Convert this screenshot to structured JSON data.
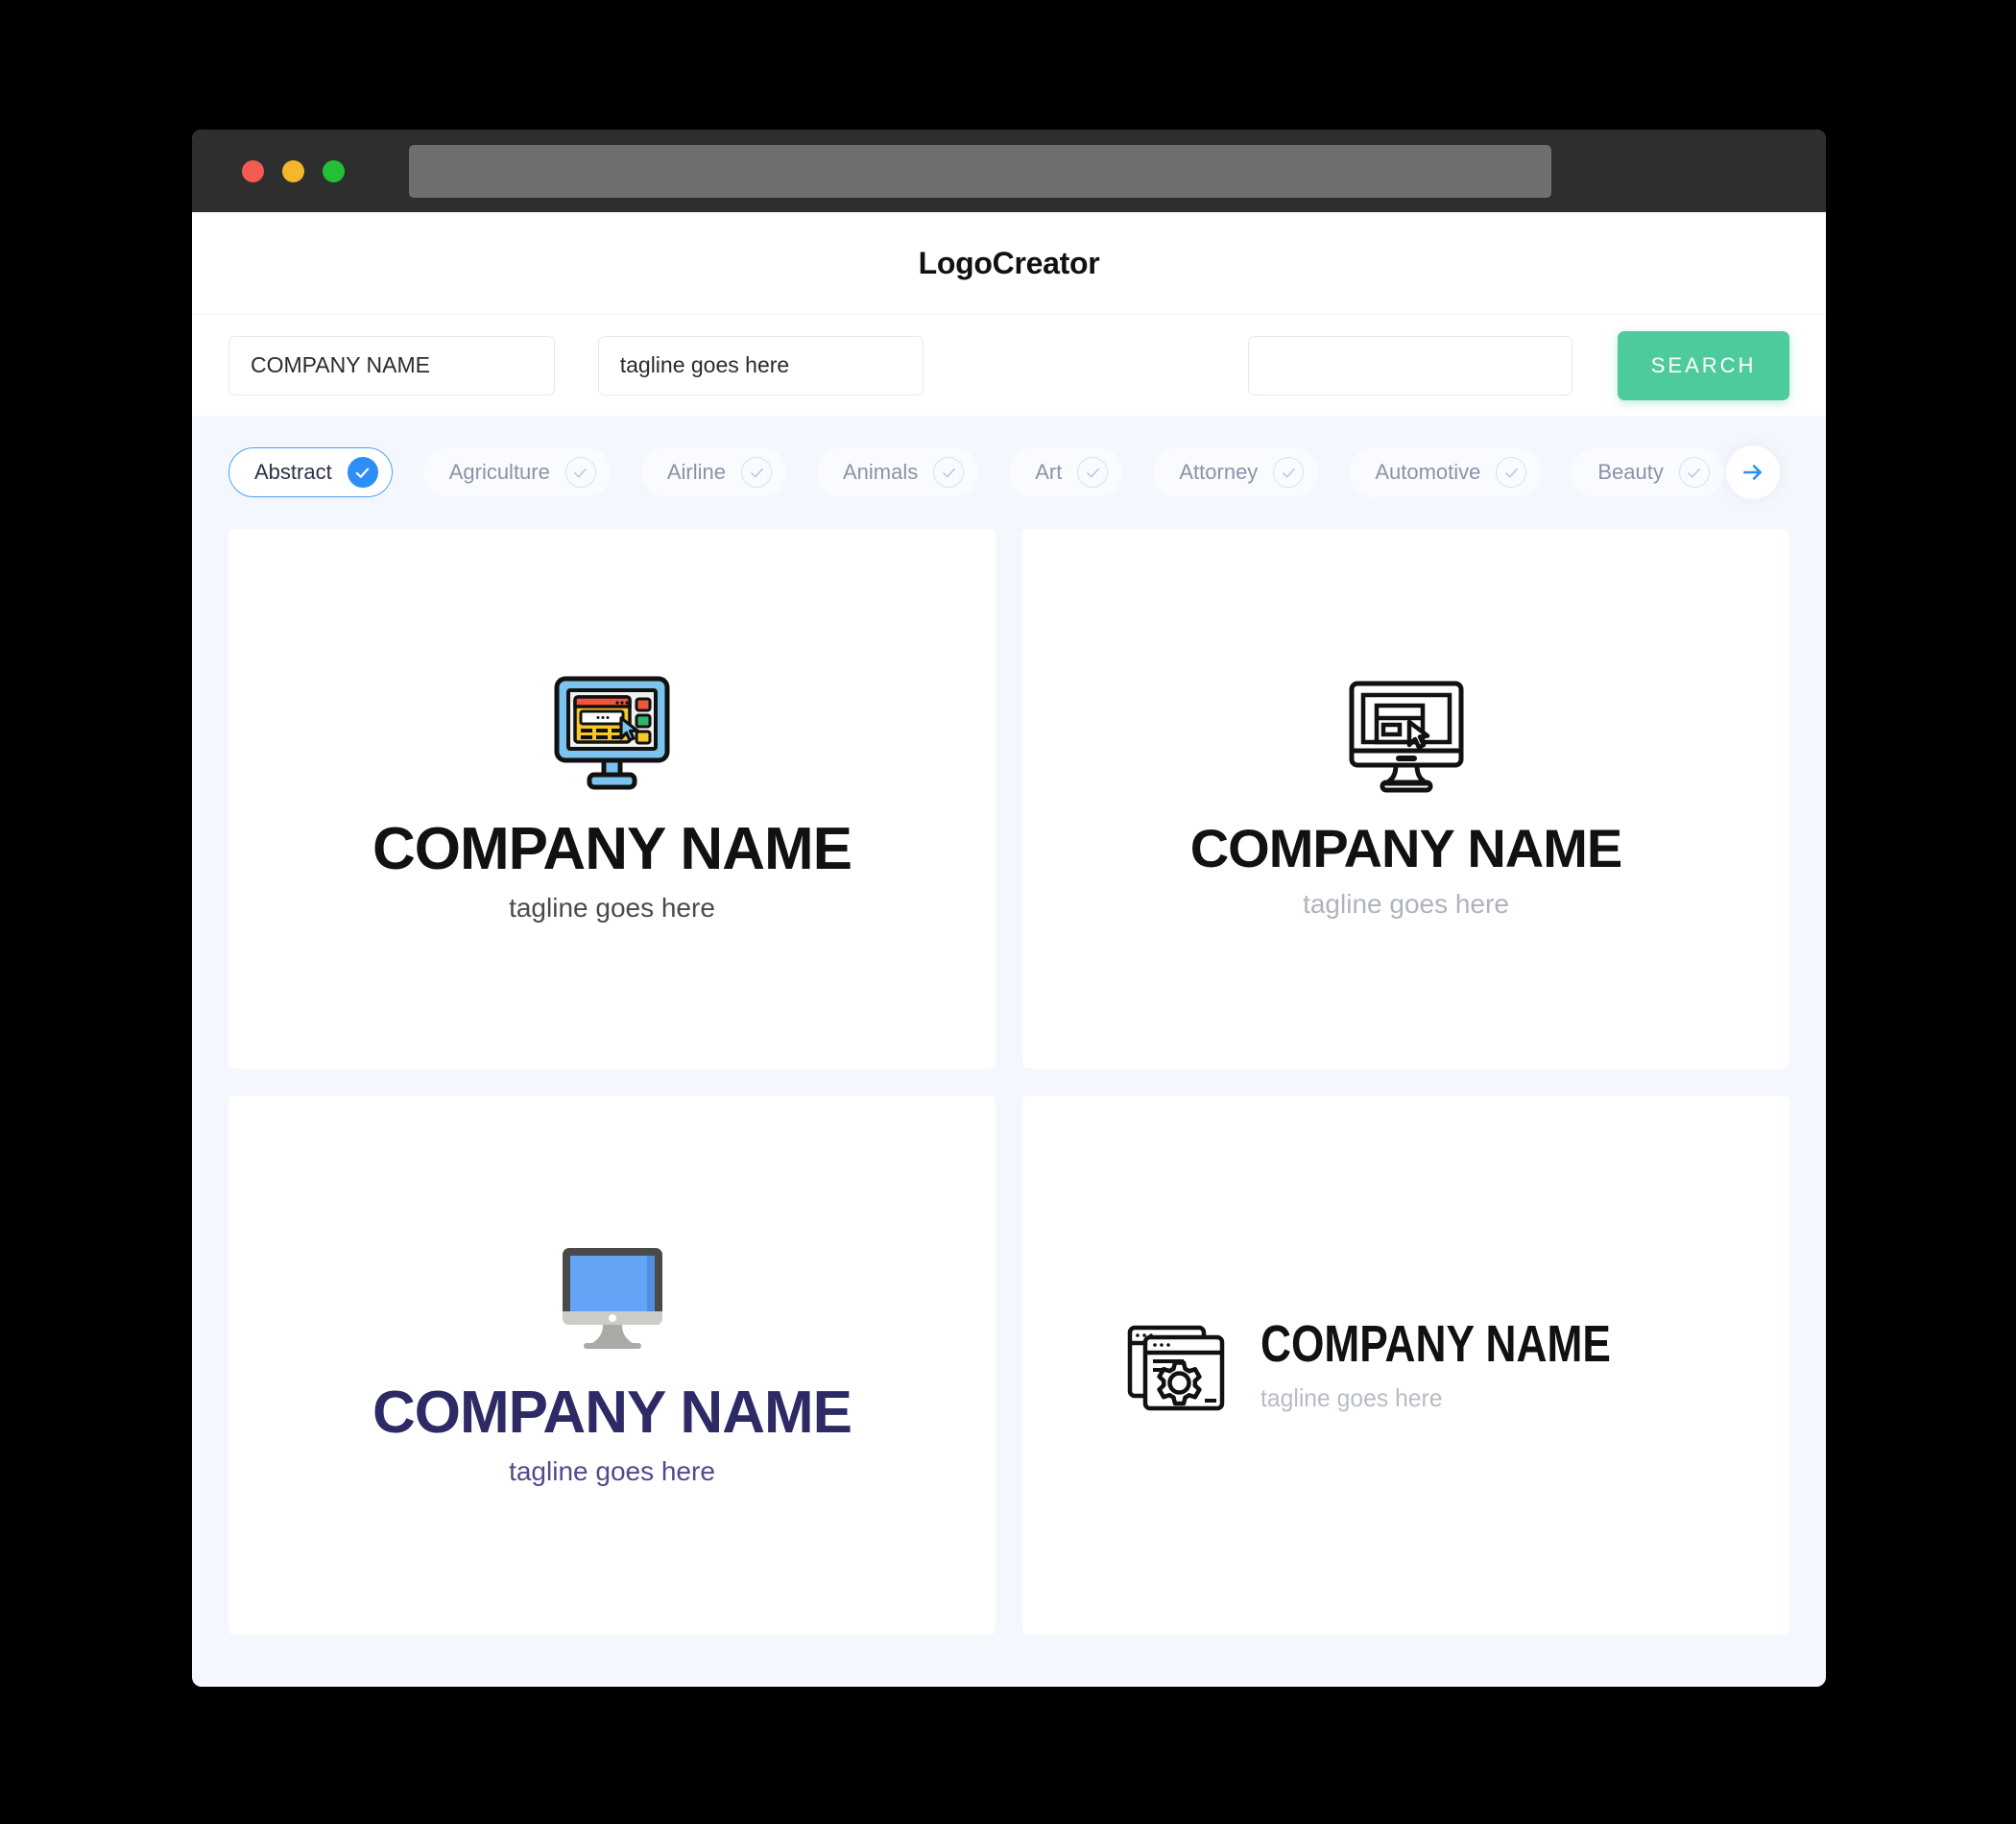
{
  "window": {
    "traffic_lights": [
      {
        "name": "close",
        "color": "#f25b52"
      },
      {
        "name": "minimize",
        "color": "#f5b52c"
      },
      {
        "name": "maximize",
        "color": "#22c035"
      }
    ],
    "url_value": ""
  },
  "header": {
    "title": "LogoCreator"
  },
  "search": {
    "company_value": "COMPANY NAME",
    "company_placeholder": "COMPANY NAME",
    "tagline_value": "tagline goes here",
    "tagline_placeholder": "tagline goes here",
    "extra_value": "",
    "extra_placeholder": "",
    "button_label": "SEARCH",
    "button_color": "#4ecb9c"
  },
  "categories": {
    "next_icon": "arrow-right-icon",
    "accent_color": "#2e8ef7",
    "items": [
      {
        "label": "Abstract",
        "selected": true
      },
      {
        "label": "Agriculture",
        "selected": false
      },
      {
        "label": "Airline",
        "selected": false
      },
      {
        "label": "Animals",
        "selected": false
      },
      {
        "label": "Art",
        "selected": false
      },
      {
        "label": "Attorney",
        "selected": false
      },
      {
        "label": "Automotive",
        "selected": false
      },
      {
        "label": "Beauty",
        "selected": false
      }
    ]
  },
  "results": [
    {
      "icon": "color-monitor-browser-cursor-icon",
      "company": "COMPANY NAME",
      "tagline": "tagline goes here",
      "company_color": "#111111",
      "tagline_color": "#4a4a4a",
      "layout": "stacked"
    },
    {
      "icon": "outline-monitor-window-cursor-icon",
      "company": "COMPANY NAME",
      "tagline": "tagline goes here",
      "company_color": "#111111",
      "tagline_color": "#aeb3bd",
      "layout": "stacked"
    },
    {
      "icon": "flat-imac-monitor-icon",
      "company": "COMPANY NAME",
      "tagline": "tagline goes here",
      "company_color": "#2d2a66",
      "tagline_color": "#4f4b8c",
      "layout": "stacked"
    },
    {
      "icon": "browser-windows-gear-icon",
      "company": "COMPANY NAME",
      "tagline": "tagline goes here",
      "company_color": "#111111",
      "tagline_color": "#b8bcc4",
      "layout": "horizontal"
    }
  ]
}
